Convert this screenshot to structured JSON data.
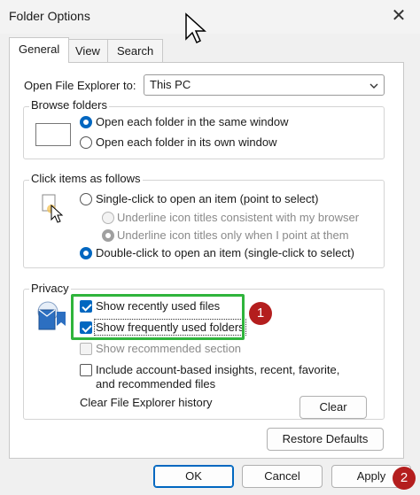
{
  "window": {
    "title": "Folder Options",
    "close_icon": "close-icon"
  },
  "tabs": [
    {
      "label": "General",
      "active": true
    },
    {
      "label": "View",
      "active": false
    },
    {
      "label": "Search",
      "active": false
    }
  ],
  "open_to": {
    "label": "Open File Explorer to:",
    "value": "This PC"
  },
  "browse": {
    "legend": "Browse folders",
    "options": [
      {
        "label": "Open each folder in the same window",
        "selected": true
      },
      {
        "label": "Open each folder in its own window",
        "selected": false
      }
    ]
  },
  "click": {
    "legend": "Click items as follows",
    "single": "Single-click to open an item (point to select)",
    "underline_browser": "Underline icon titles consistent with my browser",
    "underline_point": "Underline icon titles only when I point at them",
    "double": "Double-click to open an item (single-click to select)"
  },
  "privacy": {
    "legend": "Privacy",
    "recent_files": "Show recently used files",
    "frequent_folders": "Show frequently used folders",
    "recommended": "Show recommended section",
    "insights": "Include account-based insights, recent, favorite, and recommended files",
    "clear_label": "Clear File Explorer history",
    "clear_button": "Clear"
  },
  "restore_button": "Restore Defaults",
  "footer": {
    "ok": "OK",
    "cancel": "Cancel",
    "apply": "Apply"
  },
  "annotations": {
    "badge1": "1",
    "badge2": "2",
    "highlight_color": "#2fb43c",
    "badge_color": "#b41e1e"
  }
}
